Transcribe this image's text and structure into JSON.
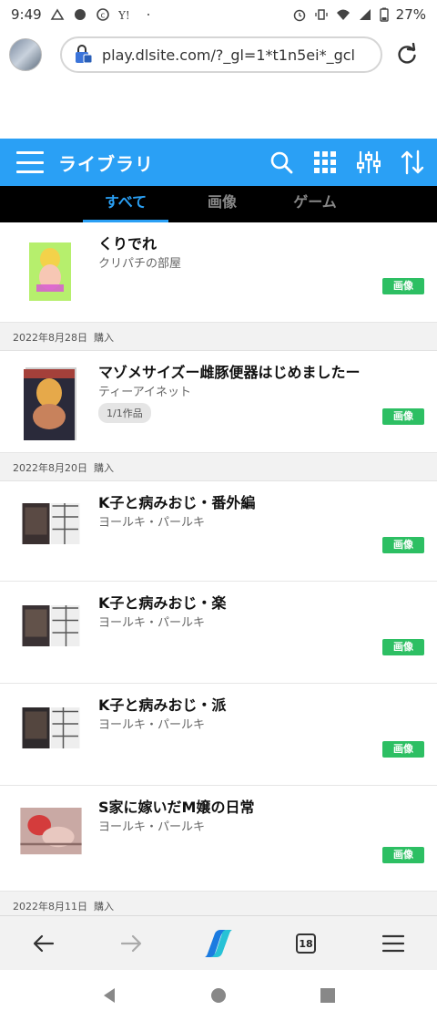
{
  "status": {
    "time": "9:49",
    "battery": "27%"
  },
  "browser": {
    "url": "play.dlsite.com/?_gl=1*t1n5ei*_gcl",
    "tab_count": "18"
  },
  "app": {
    "title": "ライブラリ",
    "tabs": [
      {
        "label": "すべて",
        "active": true
      },
      {
        "label": "画像",
        "active": false
      },
      {
        "label": "ゲーム",
        "active": false
      }
    ]
  },
  "purchase_label": "購入",
  "dates": [
    "2022年8月28日",
    "2022年8月20日",
    "2022年8月11日"
  ],
  "items": [
    {
      "title": "くりでれ",
      "circle": "クリパチの部屋",
      "badge": "画像"
    },
    {
      "title": "マゾメサイズー雌豚便器はじめましたー",
      "circle": "ティーアイネット",
      "count": "1/1作品",
      "badge": "画像"
    },
    {
      "title": "K子と病みおじ・番外編",
      "circle": "ヨールキ・パールキ",
      "badge": "画像"
    },
    {
      "title": "K子と病みおじ・楽",
      "circle": "ヨールキ・パールキ",
      "badge": "画像"
    },
    {
      "title": "K子と病みおじ・派",
      "circle": "ヨールキ・パールキ",
      "badge": "画像"
    },
    {
      "title": "S家に嫁いだM嬢の日常",
      "circle": "ヨールキ・パールキ",
      "badge": "画像"
    }
  ],
  "colors": {
    "accent": "#2aa0f5",
    "badge": "#2dbf63",
    "tabbar": "#000000"
  }
}
